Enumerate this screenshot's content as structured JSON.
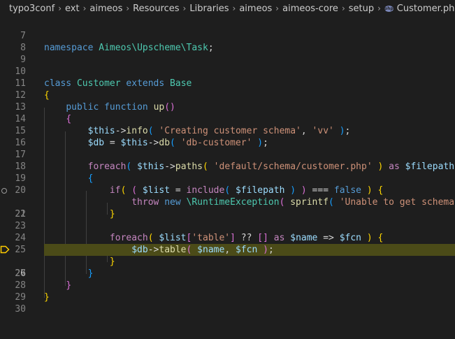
{
  "breadcrumb": {
    "items": [
      "typo3conf",
      "ext",
      "aimeos",
      "Resources",
      "Libraries",
      "aimeos",
      "aimeos-core",
      "setup"
    ],
    "file_icon": "php-file-icon",
    "file": "Customer.php"
  },
  "gutter": {
    "lines": [
      "7",
      "8",
      "9",
      "10",
      "11",
      "12",
      "13",
      "14",
      "15",
      "16",
      "17",
      "18",
      "19",
      "20",
      "21",
      "22",
      "23",
      "24",
      "25",
      "26",
      "27",
      "28",
      "29",
      "30"
    ]
  },
  "code": {
    "l9": {
      "kw": "namespace",
      "ns": "Aimeos\\Upscheme\\Task",
      "end": ";"
    },
    "l12": {
      "kw1": "class",
      "cls1": "Customer",
      "kw2": "extends",
      "cls2": "Base"
    },
    "l13": {
      "b": "{"
    },
    "l14": {
      "kw1": "public",
      "kw2": "function",
      "fn": "up",
      "b": "()"
    },
    "l15": {
      "b": "{"
    },
    "l16": {
      "v": "$this",
      "op": "->",
      "fn": "info",
      "b1": "(",
      "s1": "'Creating customer schema'",
      "c": ", ",
      "s2": "'vv'",
      "b2": ")",
      "end": ";"
    },
    "l17": {
      "v1": "$db",
      "eq": " = ",
      "v2": "$this",
      "op": "->",
      "fn": "db",
      "b1": "(",
      "s": "'db-customer'",
      "b2": ")",
      "end": ";"
    },
    "l19": {
      "ctl": "foreach",
      "b1": "(",
      "v": "$this",
      "op": "->",
      "fn": "paths",
      "b2": "(",
      "s": "'default/schema/customer.php'",
      "b3": ")",
      "as": "as",
      "v2": "$filepath",
      "b4": ")"
    },
    "l20": {
      "b": "{"
    },
    "l21": {
      "ctl": "if",
      "b1": "(",
      "b2": "(",
      "v": "$list",
      "eq": " = ",
      "ctl2": "include",
      "b3": "(",
      "v2": "$filepath",
      "b4": ")",
      "b5": ")",
      "op": " === ",
      "kw": "false",
      "b6": ")",
      "b7": "{"
    },
    "l22": {
      "ctl": "throw",
      "kw": "new",
      "cls": "\\RuntimeException",
      "b1": "(",
      "fn": "sprintf",
      "b2": "(",
      "s": "'Unable to get schema fr"
    },
    "l23": {
      "b": "}"
    },
    "l25": {
      "ctl": "foreach",
      "b1": "(",
      "v": "$list",
      "b2": "[",
      "s": "'table'",
      "b3": "]",
      "op": " ?? ",
      "arr": "[]",
      "as": "as",
      "v2": "$name",
      "arrow": " => ",
      "v3": "$fcn",
      "b4": ")",
      "b5": "{"
    },
    "l26": {
      "v": "$db",
      "op": "->",
      "fn": "table",
      "b1": "(",
      "v2": "$name",
      "c": ", ",
      "v3": "$fcn",
      "b2": ")",
      "end": ";"
    },
    "l27": {
      "b": "}"
    },
    "l28": {
      "b": "}"
    },
    "l29": {
      "b": "}"
    },
    "l30": {
      "b": "}"
    }
  },
  "colors": {
    "background": "#1e1e1e",
    "current_line": "#4b4b18",
    "keyword": "#569cd6",
    "string": "#ce9178",
    "variable": "#9cdcfe",
    "function": "#dcdcaa"
  }
}
